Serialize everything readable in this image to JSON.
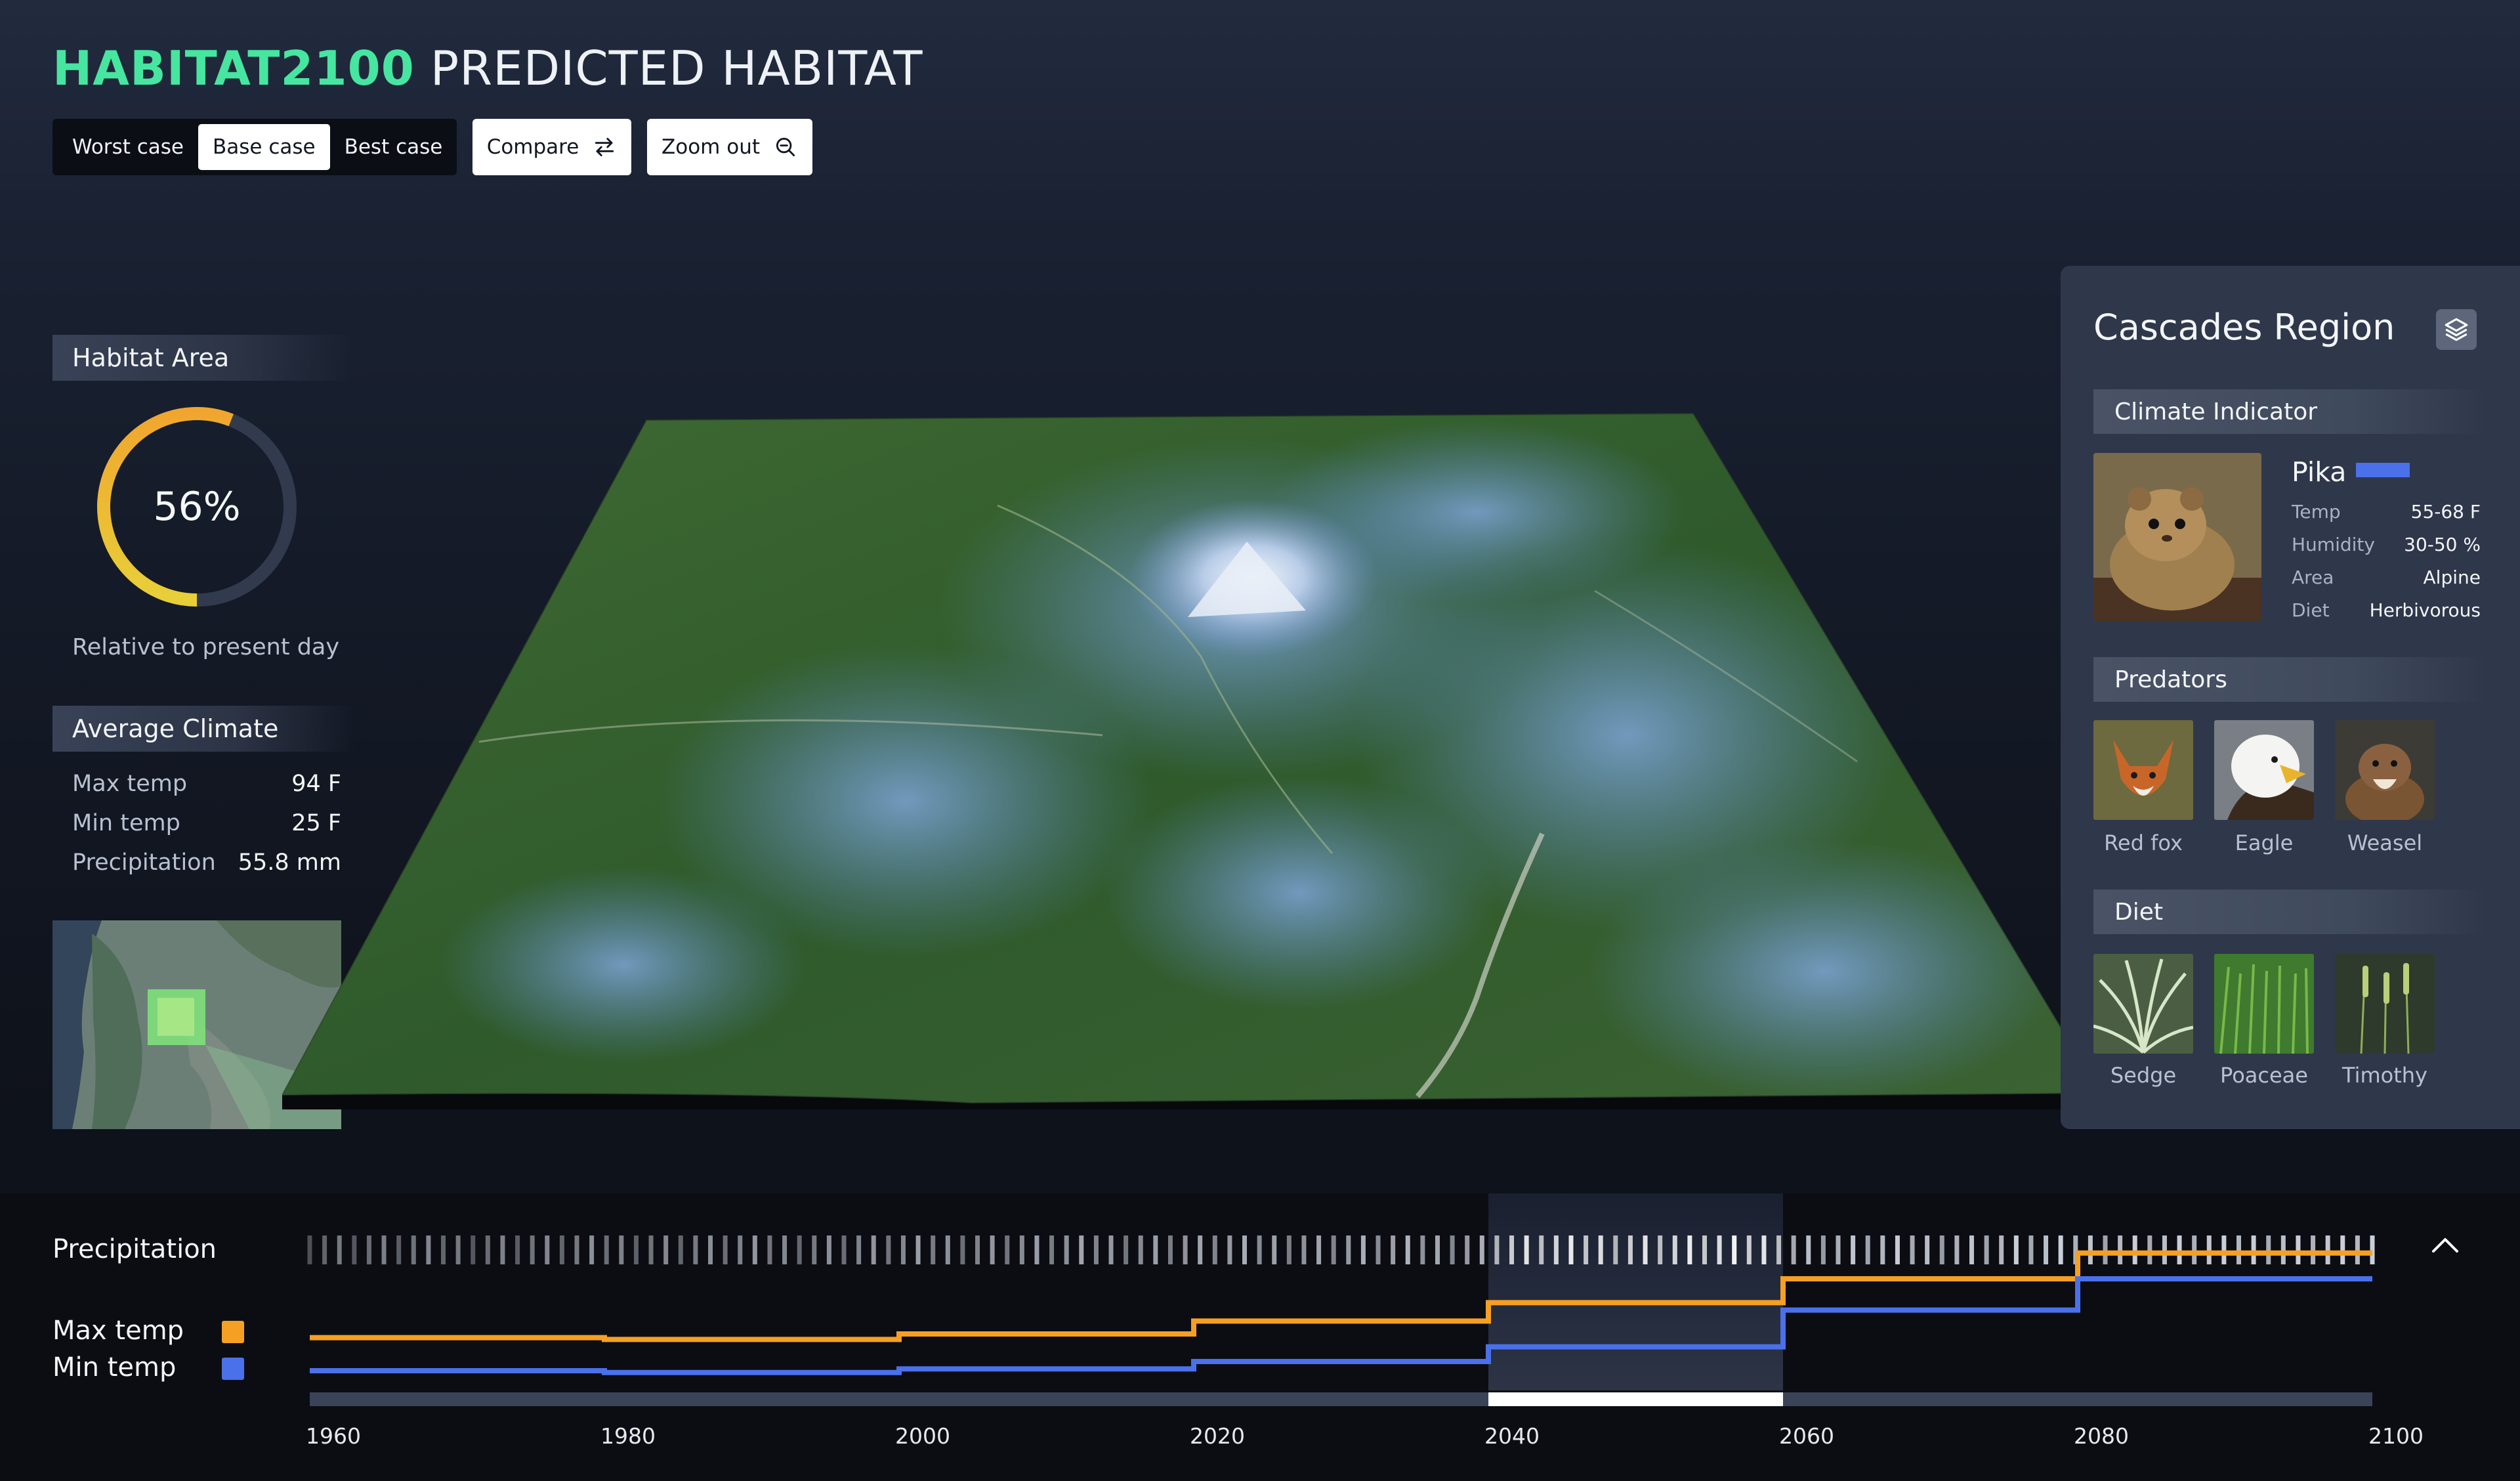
{
  "header": {
    "brand": "HABITAT2100",
    "title": "PREDICTED HABITAT",
    "scenarios": [
      {
        "label": "Worst case",
        "active": false
      },
      {
        "label": "Base case",
        "active": true
      },
      {
        "label": "Best case",
        "active": false
      }
    ],
    "compare_label": "Compare",
    "zoom_label": "Zoom out"
  },
  "habitat": {
    "heading": "Habitat Area",
    "percent_label": "56%",
    "percent": 56,
    "caption": "Relative to present day",
    "colors": {
      "start": "#f0a62e",
      "end": "#e8cf38",
      "track": "#323a4e"
    }
  },
  "climate": {
    "heading": "Average Climate",
    "rows": [
      {
        "label": "Max temp",
        "value": "94 F"
      },
      {
        "label": "Min temp",
        "value": "25 F"
      },
      {
        "label": "Precipitation",
        "value": "55.8 mm"
      }
    ]
  },
  "region": {
    "title": "Cascades Region",
    "indicator_heading": "Climate Indicator",
    "species": {
      "name": "Pika",
      "swatch_color": "#4a70ea",
      "traits": [
        {
          "label": "Temp",
          "value": "55-68  F"
        },
        {
          "label": "Humidity",
          "value": "30-50 %"
        },
        {
          "label": "Area",
          "value": "Alpine"
        },
        {
          "label": "Diet",
          "value": "Herbivorous"
        }
      ]
    },
    "predators_heading": "Predators",
    "predators": [
      {
        "label": "Red fox",
        "icon": "fox-photo"
      },
      {
        "label": "Eagle",
        "icon": "eagle-photo"
      },
      {
        "label": "Weasel",
        "icon": "weasel-photo"
      }
    ],
    "diet_heading": "Diet",
    "diet": [
      {
        "label": "Sedge",
        "icon": "sedge-photo"
      },
      {
        "label": "Poaceae",
        "icon": "poaceae-photo"
      },
      {
        "label": "Timothy",
        "icon": "timothy-photo"
      }
    ]
  },
  "timeline": {
    "precip_label": "Precipitation",
    "legend": [
      {
        "label": "Max temp",
        "color": "#f5a023"
      },
      {
        "label": "Min temp",
        "color": "#4a70ea"
      }
    ],
    "years": [
      "1960",
      "1980",
      "2000",
      "2020",
      "2040",
      "2060",
      "2080",
      "2100"
    ],
    "selected_range": [
      2040,
      2060
    ]
  },
  "chart_data": {
    "type": "line",
    "x": [
      1960,
      1980,
      2000,
      2020,
      2040,
      2060,
      2080,
      2100
    ],
    "series": [
      {
        "name": "Max temp",
        "color": "#f5a023",
        "values": [
          0.18,
          0.17,
          0.2,
          0.27,
          0.37,
          0.5,
          0.64,
          0.64
        ]
      },
      {
        "name": "Min temp",
        "color": "#4a70ea",
        "values": [
          0.0,
          -0.01,
          0.01,
          0.05,
          0.13,
          0.33,
          0.5,
          0.5
        ]
      }
    ],
    "interpolation": "step",
    "xlim": [
      1960,
      2100
    ]
  }
}
